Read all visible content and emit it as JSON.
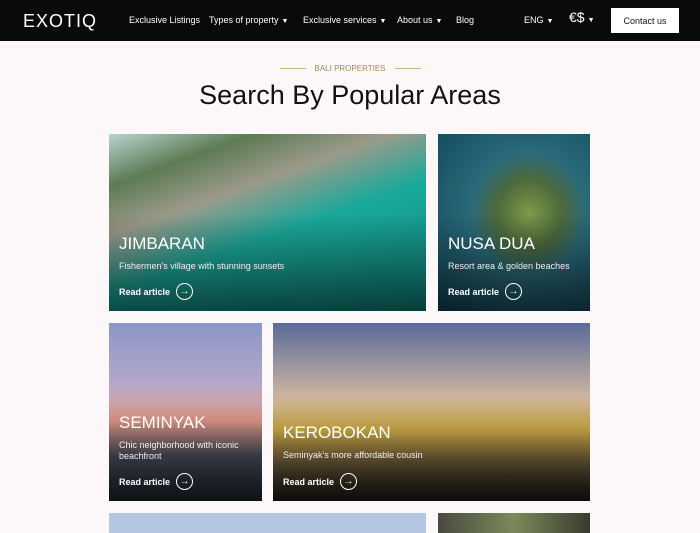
{
  "nav": {
    "logo": "EXOTIQ",
    "items": [
      {
        "label": "Exclusive Listings"
      },
      {
        "label": "Types of property",
        "dropdown": true
      },
      {
        "label": "Exclusive services",
        "dropdown": true
      },
      {
        "label": "About us",
        "dropdown": true
      },
      {
        "label": "Blog"
      }
    ],
    "language": "ENG",
    "currency_icon": "currency-exchange-icon",
    "contact": "Contact us"
  },
  "section": {
    "eyebrow": "BALI PROPERTIES",
    "title": "Search By Popular Areas"
  },
  "cards": [
    {
      "name": "Jimbaran",
      "desc": "Fishermen's village with stunning sunsets",
      "cta": "Read article"
    },
    {
      "name": "Nusa Dua",
      "desc": "Resort area & golden beaches",
      "cta": "Read article"
    },
    {
      "name": "Seminyak",
      "desc": "Chic neighborhood with iconic beachfront",
      "cta": "Read article"
    },
    {
      "name": "Kerobokan",
      "desc": "Seminyak's more affordable cousin",
      "cta": "Read article"
    }
  ]
}
